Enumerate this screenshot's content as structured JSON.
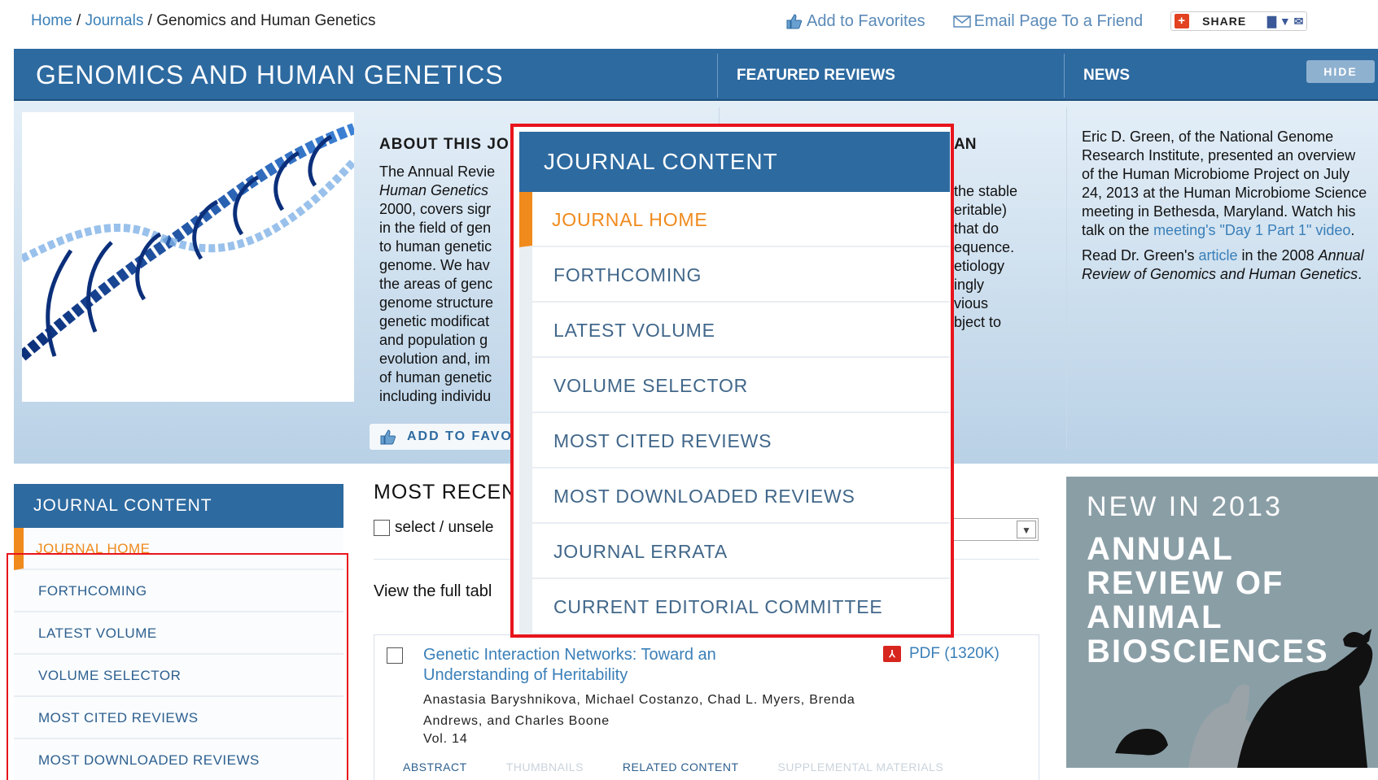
{
  "breadcrumb": {
    "home": "Home",
    "journals": "Journals",
    "current": "Genomics and Human Genetics",
    "sep": "/"
  },
  "toplinks": {
    "favorites": "Add to Favorites",
    "email": "Email Page To a Friend",
    "share": "SHARE"
  },
  "header": {
    "title": "GENOMICS AND HUMAN GENETICS",
    "featured_tab": "FEATURED REVIEWS",
    "news_tab": "NEWS",
    "hide_button": "HIDE"
  },
  "about": {
    "heading": "ABOUT THIS JO",
    "lines": [
      "The Annual Revie",
      "Human Genetics",
      "2000, covers sigr",
      "in the field of gen",
      "to human genetic",
      "genome. We hav",
      "the areas of genc",
      "genome structure",
      "genetic modificat",
      "and population g",
      "evolution and, im",
      "of human genetic",
      "including individu"
    ],
    "add_favorites": "ADD TO FAVO"
  },
  "featured": {
    "heading": "AN",
    "lines": [
      "the stable",
      "eritable)",
      "that do",
      "equence.",
      "etiology",
      "ingly",
      "vious",
      "bject to"
    ]
  },
  "news": {
    "p1_before": "Eric D. Green, of the National Genome Research Institute, presented an overview of the Human Microbiome Project on July 24, 2013 at the Human Microbiome Science meeting in Bethesda, Maryland. Watch his talk on the ",
    "p1_link": "meeting's \"Day 1 Part 1\" video",
    "p1_after": ".",
    "p2_before": "Read Dr. Green's ",
    "p2_link": "article",
    "p2_after": " in the 2008",
    "p2_italic": "Annual Review of Genomics and Human Genetics",
    "p2_end": "."
  },
  "sidebar": {
    "heading": "JOURNAL CONTENT",
    "items": [
      {
        "label": "JOURNAL HOME"
      },
      {
        "label": "FORTHCOMING"
      },
      {
        "label": "LATEST VOLUME"
      },
      {
        "label": "VOLUME SELECTOR"
      },
      {
        "label": "MOST CITED REVIEWS"
      },
      {
        "label": "MOST DOWNLOADED REVIEWS"
      }
    ]
  },
  "main": {
    "heading": "MOST RECEN",
    "select_label": "select / unsele",
    "view_full": "View the full tabl",
    "article": {
      "title": "Genetic Interaction Networks: Toward an Understanding of Heritability",
      "authors": "Anastasia Baryshnikova, Michael Costanzo, Chad L. Myers, Brenda Andrews, and Charles Boone",
      "volume": "Vol. 14",
      "pdf": "PDF (1320K)",
      "tabs": [
        "ABSTRACT",
        "THUMBNAILS",
        "RELATED CONTENT",
        "SUPPLEMENTAL MATERIALS"
      ]
    }
  },
  "ad": {
    "line1": "NEW IN 2013",
    "line2": "ANNUAL REVIEW OF ANIMAL BIOSCIENCES"
  },
  "popup": {
    "heading": "JOURNAL CONTENT",
    "items": [
      {
        "label": "JOURNAL HOME"
      },
      {
        "label": "FORTHCOMING"
      },
      {
        "label": "LATEST VOLUME"
      },
      {
        "label": "VOLUME SELECTOR"
      },
      {
        "label": "MOST CITED REVIEWS"
      },
      {
        "label": "MOST DOWNLOADED REVIEWS"
      },
      {
        "label": "JOURNAL ERRATA"
      },
      {
        "label": "CURRENT EDITORIAL COMMITTEE"
      }
    ]
  },
  "colors": {
    "brand_blue": "#2d6aa0",
    "accent_orange": "#f08a1c",
    "highlight_red": "#e8141c"
  }
}
